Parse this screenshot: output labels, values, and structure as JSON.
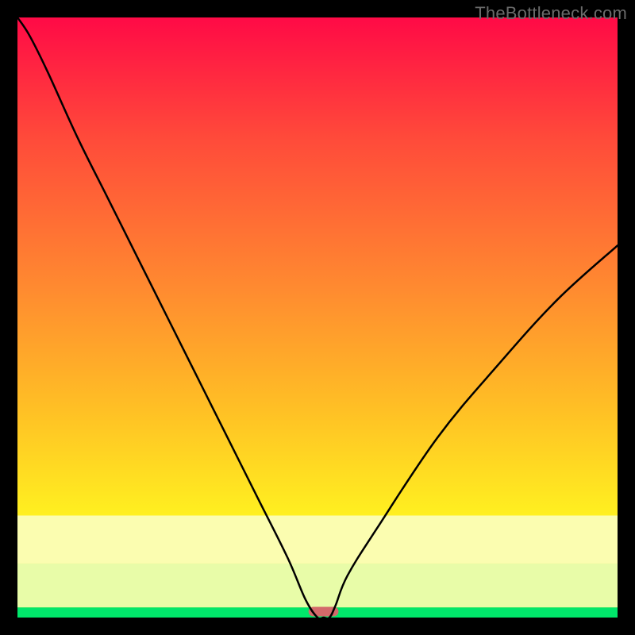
{
  "watermark": "TheBottleneck.com",
  "chart_data": {
    "type": "line",
    "title": "",
    "xlabel": "",
    "ylabel": "",
    "xlim": [
      0,
      100
    ],
    "ylim": [
      0,
      100
    ],
    "grid": false,
    "series": [
      {
        "name": "bottleneck-curve",
        "x": [
          0,
          2,
          5,
          10,
          15,
          20,
          25,
          30,
          35,
          40,
          45,
          48,
          50,
          51,
          52,
          53,
          55,
          60,
          70,
          80,
          90,
          100
        ],
        "y": [
          100,
          97,
          91,
          80,
          70,
          60,
          50,
          40,
          30,
          20,
          10,
          3,
          0,
          0,
          0,
          2,
          7,
          15,
          30,
          42,
          53,
          62
        ]
      }
    ],
    "bottom_bands": [
      {
        "name": "green-band",
        "y0": 98.3,
        "y1": 100.0,
        "color": "#00e66a"
      },
      {
        "name": "pale-green-band",
        "y0": 91.0,
        "y1": 98.3,
        "color": "#e8fca8"
      },
      {
        "name": "pale-yellow-band",
        "y0": 83.0,
        "y1": 91.0,
        "color": "#fbfdb0"
      }
    ],
    "marker": {
      "name": "bottleneck-marker",
      "x_center": 51,
      "width": 5,
      "y": 99,
      "color": "#d36a6a"
    },
    "gradient_stops": [
      {
        "offset": 0.0,
        "color": "#ff0a46"
      },
      {
        "offset": 0.2,
        "color": "#ff4a3a"
      },
      {
        "offset": 0.45,
        "color": "#ff8a30"
      },
      {
        "offset": 0.65,
        "color": "#ffbf25"
      },
      {
        "offset": 0.83,
        "color": "#fff020"
      },
      {
        "offset": 1.0,
        "color": "#fff020"
      }
    ]
  }
}
